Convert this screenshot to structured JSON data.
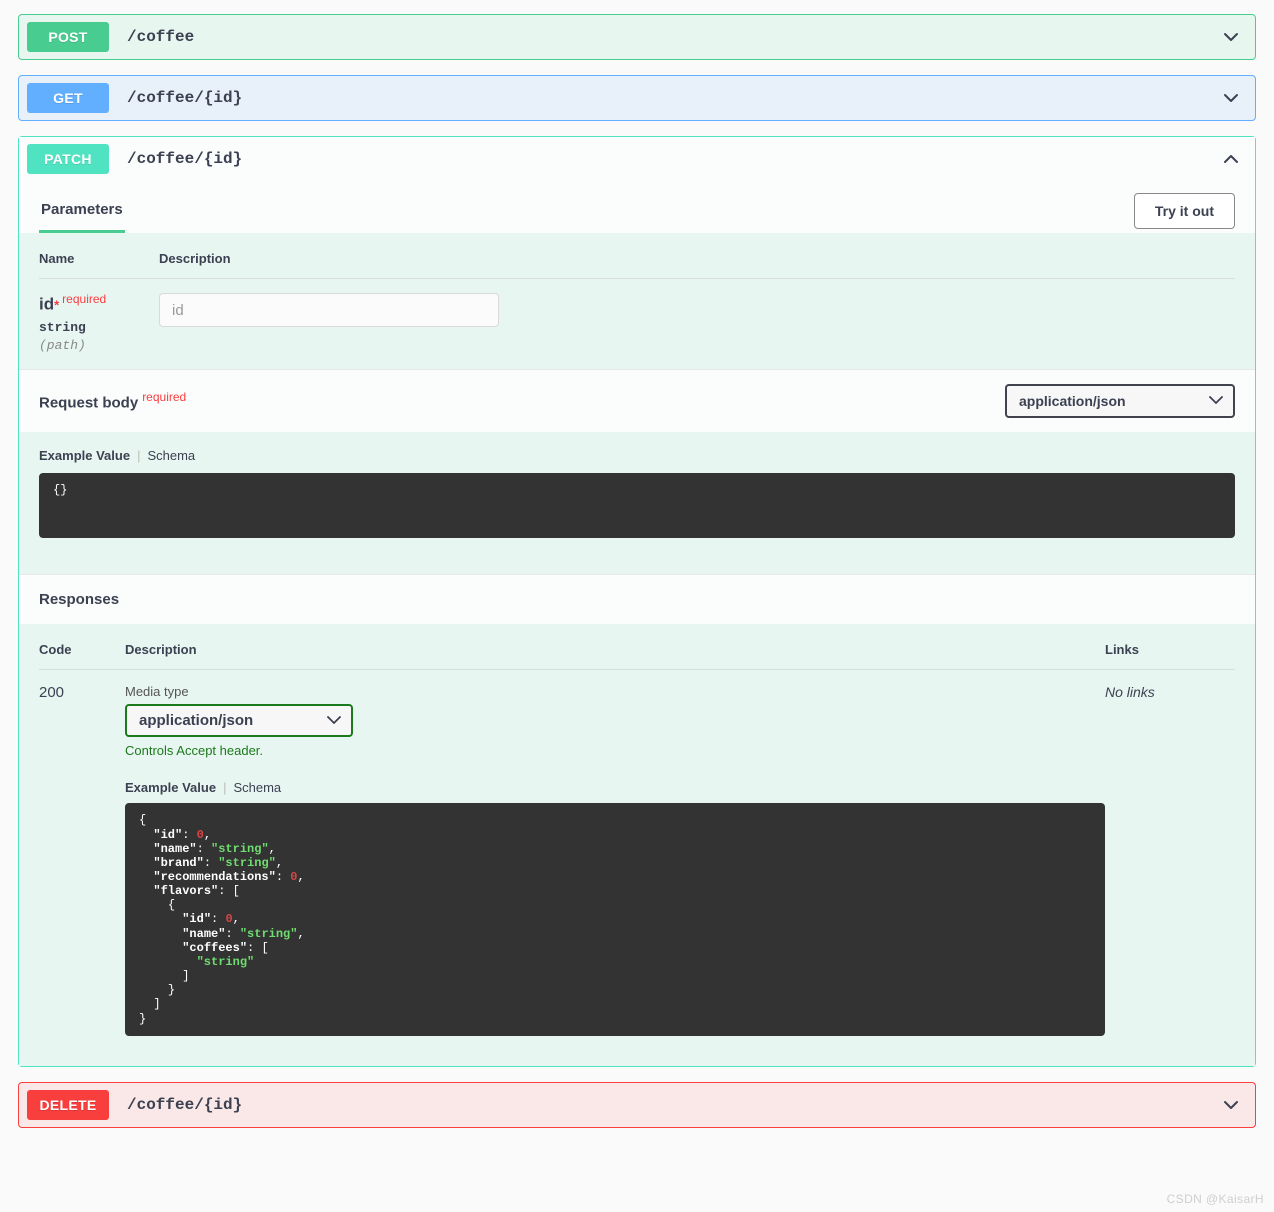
{
  "operations": [
    {
      "method": "POST",
      "method_class": "post",
      "path_prefix": "/coffee",
      "path_suffix": "",
      "expanded": false,
      "chevron": "chevron-down-icon"
    },
    {
      "method": "GET",
      "method_class": "get",
      "path_prefix": "/coffee/",
      "path_suffix": "{id}",
      "expanded": false,
      "chevron": "chevron-down-icon"
    },
    {
      "method": "PATCH",
      "method_class": "patch",
      "path_prefix": "/coffee/",
      "path_suffix": "{id}",
      "expanded": true,
      "chevron": "chevron-up-icon"
    },
    {
      "method": "DELETE",
      "method_class": "delete",
      "path_prefix": "/coffee/",
      "path_suffix": "{id}",
      "expanded": false,
      "chevron": "chevron-down-icon"
    }
  ],
  "patch_panel": {
    "tab_label": "Parameters",
    "try_it_out_label": "Try it out",
    "params_table": {
      "header_name": "Name",
      "header_description": "Description",
      "rows": [
        {
          "name": "id",
          "required_marker": "*",
          "required_label": "required",
          "type": "string",
          "location": "(path)",
          "input_value": "",
          "input_placeholder": "id"
        }
      ]
    },
    "request_body": {
      "title": "Request body",
      "required_label": "required",
      "content_type_selected": "application/json",
      "content_type_options": [
        "application/json"
      ],
      "example_tab": "Example Value",
      "schema_tab": "Schema",
      "example_code": "{}"
    },
    "responses": {
      "title": "Responses",
      "header_code": "Code",
      "header_description": "Description",
      "header_links": "Links",
      "rows": [
        {
          "code": "200",
          "links": "No links",
          "media_type_label": "Media type",
          "media_type_selected": "application/json",
          "media_type_options": [
            "application/json"
          ],
          "accept_hint": "Controls Accept header.",
          "example_tab": "Example Value",
          "schema_tab": "Schema",
          "example_code_lines": [
            "{",
            "  \"id\": 0,",
            "  \"name\": \"string\",",
            "  \"brand\": \"string\",",
            "  \"recommendations\": 0,",
            "  \"flavors\": [",
            "    {",
            "      \"id\": 0,",
            "      \"name\": \"string\",",
            "      \"coffees\": [",
            "        \"string\"",
            "      ]",
            "    }",
            "  ]",
            "}"
          ]
        }
      ]
    }
  },
  "watermark": "CSDN @KaisarH",
  "colors": {
    "post": "#49cc90",
    "get": "#61affe",
    "patch": "#50e3c2",
    "delete": "#f93e3e",
    "code_bg": "#333333",
    "panel_bg": "#e8f6f2"
  }
}
